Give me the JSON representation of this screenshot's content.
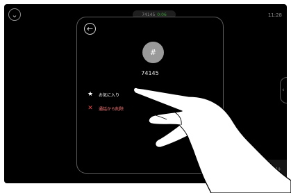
{
  "status_bar": {
    "call_number": "74145",
    "call_duration": "0:06",
    "clock": "11:28"
  },
  "contact": {
    "avatar_symbol": "#",
    "number": "74145"
  },
  "menu": {
    "favorite_label": "お気に入り",
    "remove_label": "通話から削除"
  },
  "icons": {
    "top_left": "chevron-down-icon",
    "back": "back-arrow-icon",
    "favorite": "star-icon",
    "remove": "close-icon",
    "side": "chevron-left-icon",
    "speaker_left": "speaker-icon",
    "speaker_right": "speaker-icon"
  },
  "colors": {
    "background": "#000000",
    "avatar": "#9a9a9a",
    "duration": "#3e9a3a",
    "remove": "#e24848"
  }
}
